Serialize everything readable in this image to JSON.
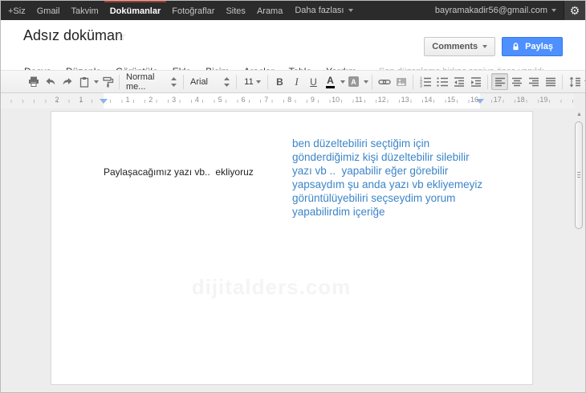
{
  "topbar": {
    "items": [
      "+Siz",
      "Gmail",
      "Takvim",
      "Dokümanlar",
      "Fotoğraflar",
      "Sites",
      "Arama"
    ],
    "active_item": "Dokümanlar",
    "more_label": "Daha fazlası",
    "account_email": "bayramakadir56@gmail.com"
  },
  "header": {
    "doc_title": "Adsız doküman",
    "menus": [
      "Dosya",
      "Düzenle",
      "Görüntüle",
      "Ekle",
      "Biçim",
      "Araçlar",
      "Tablo",
      "Yardım"
    ],
    "status_text": "Son düzenleme birkaç saniye önce yapıldı",
    "comments_button": "Comments",
    "share_button": "Paylaş"
  },
  "toolbar": {
    "style_dropdown": "Normal me...",
    "font_dropdown": "Arial",
    "font_size": "11",
    "bold_label": "B",
    "italic_label": "I",
    "underline_label": "U",
    "text_color_label": "A",
    "highlight_label": "A"
  },
  "ruler": {
    "left_numbers": [
      "2",
      "1"
    ],
    "main_numbers": [
      "1",
      "2",
      "3",
      "4",
      "5",
      "6",
      "7",
      "8",
      "9",
      "10",
      "11",
      "12",
      "13",
      "14",
      "15",
      "16"
    ],
    "right_numbers": [
      "17",
      "18",
      "19"
    ]
  },
  "document": {
    "black_text": "Paylaşacağımız yazı vb..  ekliyoruz",
    "blue_lines": [
      "ben düzeltebiliri seçtiğim için",
      "gönderdiğimiz kişi düzeltebilir silebilir",
      "yazı vb ..  yapabilir eğer görebilir",
      "yapsaydım şu anda yazı vb ekliyemeyiz",
      "görüntülüyebiliri seçseydim yorum",
      "yapabilirdim içeriğe"
    ],
    "watermark": "dijitalders.com"
  },
  "icons": {
    "gear": "⚙",
    "star": "☆",
    "scroll_up": "▲"
  },
  "colors": {
    "topbar_bg": "#2b2b2b",
    "active_tab_red": "#a83a2c",
    "share_button_blue": "#4d90fe",
    "blue_text": "#3c85c8",
    "ruler_marker_blue": "#8cb2e9"
  }
}
